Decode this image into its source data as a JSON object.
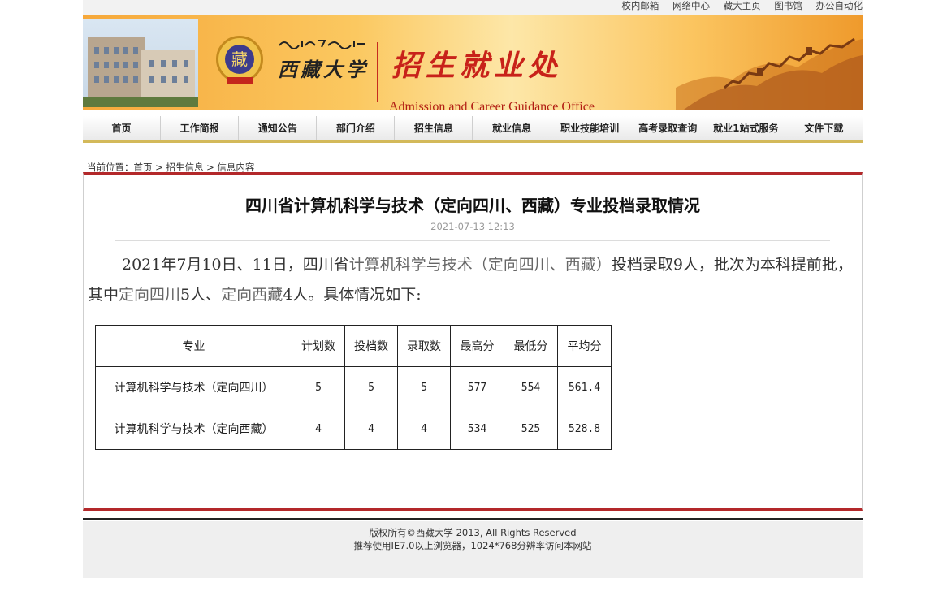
{
  "top_links": [
    "校内邮箱",
    "网络中心",
    "藏大主页",
    "图书馆",
    "办公自动化"
  ],
  "header": {
    "seal_char": "藏",
    "university_name": "西藏大学",
    "office_cn": "招生就业处",
    "office_en": "Admission and Career Guidance Office"
  },
  "nav": [
    "首页",
    "工作简报",
    "通知公告",
    "部门介绍",
    "招生信息",
    "就业信息",
    "职业技能培训",
    "高考录取查询",
    "就业1站式服务",
    "文件下载"
  ],
  "breadcrumb": {
    "label": "当前位置：",
    "home": "首页",
    "sep1": " > ",
    "section": "招生信息",
    "sep2": " > ",
    "current": "信息内容"
  },
  "article": {
    "title": "四川省计算机科学与技术（定向四川、西藏）专业投档录取情况",
    "date": "2021-07-13 12:13",
    "p_part1": "2021年7月10日、11日，四川省",
    "p_major": "计算机科学与技术（定向四川、西藏）",
    "p_part2": "投档录取9人，批次为本科提前批，其中",
    "p_sc": "定向四川",
    "p_part3": "5人、",
    "p_xz": "定向西藏",
    "p_part4": "4人。具体情况如下:"
  },
  "table": {
    "headers": [
      "专业",
      "计划数",
      "投档数",
      "录取数",
      "最高分",
      "最低分",
      "平均分"
    ],
    "rows": [
      [
        "计算机科学与技术（定向四川）",
        "5",
        "5",
        "5",
        "577",
        "554",
        "561.4"
      ],
      [
        "计算机科学与技术（定向西藏）",
        "4",
        "4",
        "4",
        "534",
        "525",
        "528.8"
      ]
    ]
  },
  "footer": {
    "line1": "版权所有©西藏大学 2013, All Rights Reserved",
    "line2": "推荐使用IE7.0以上浏览器，1024*768分辨率访问本网站"
  },
  "colors": {
    "accent_red": "#b3282a",
    "nav_gold": "#d3b95a",
    "banner_orange": "#f6a83a"
  }
}
